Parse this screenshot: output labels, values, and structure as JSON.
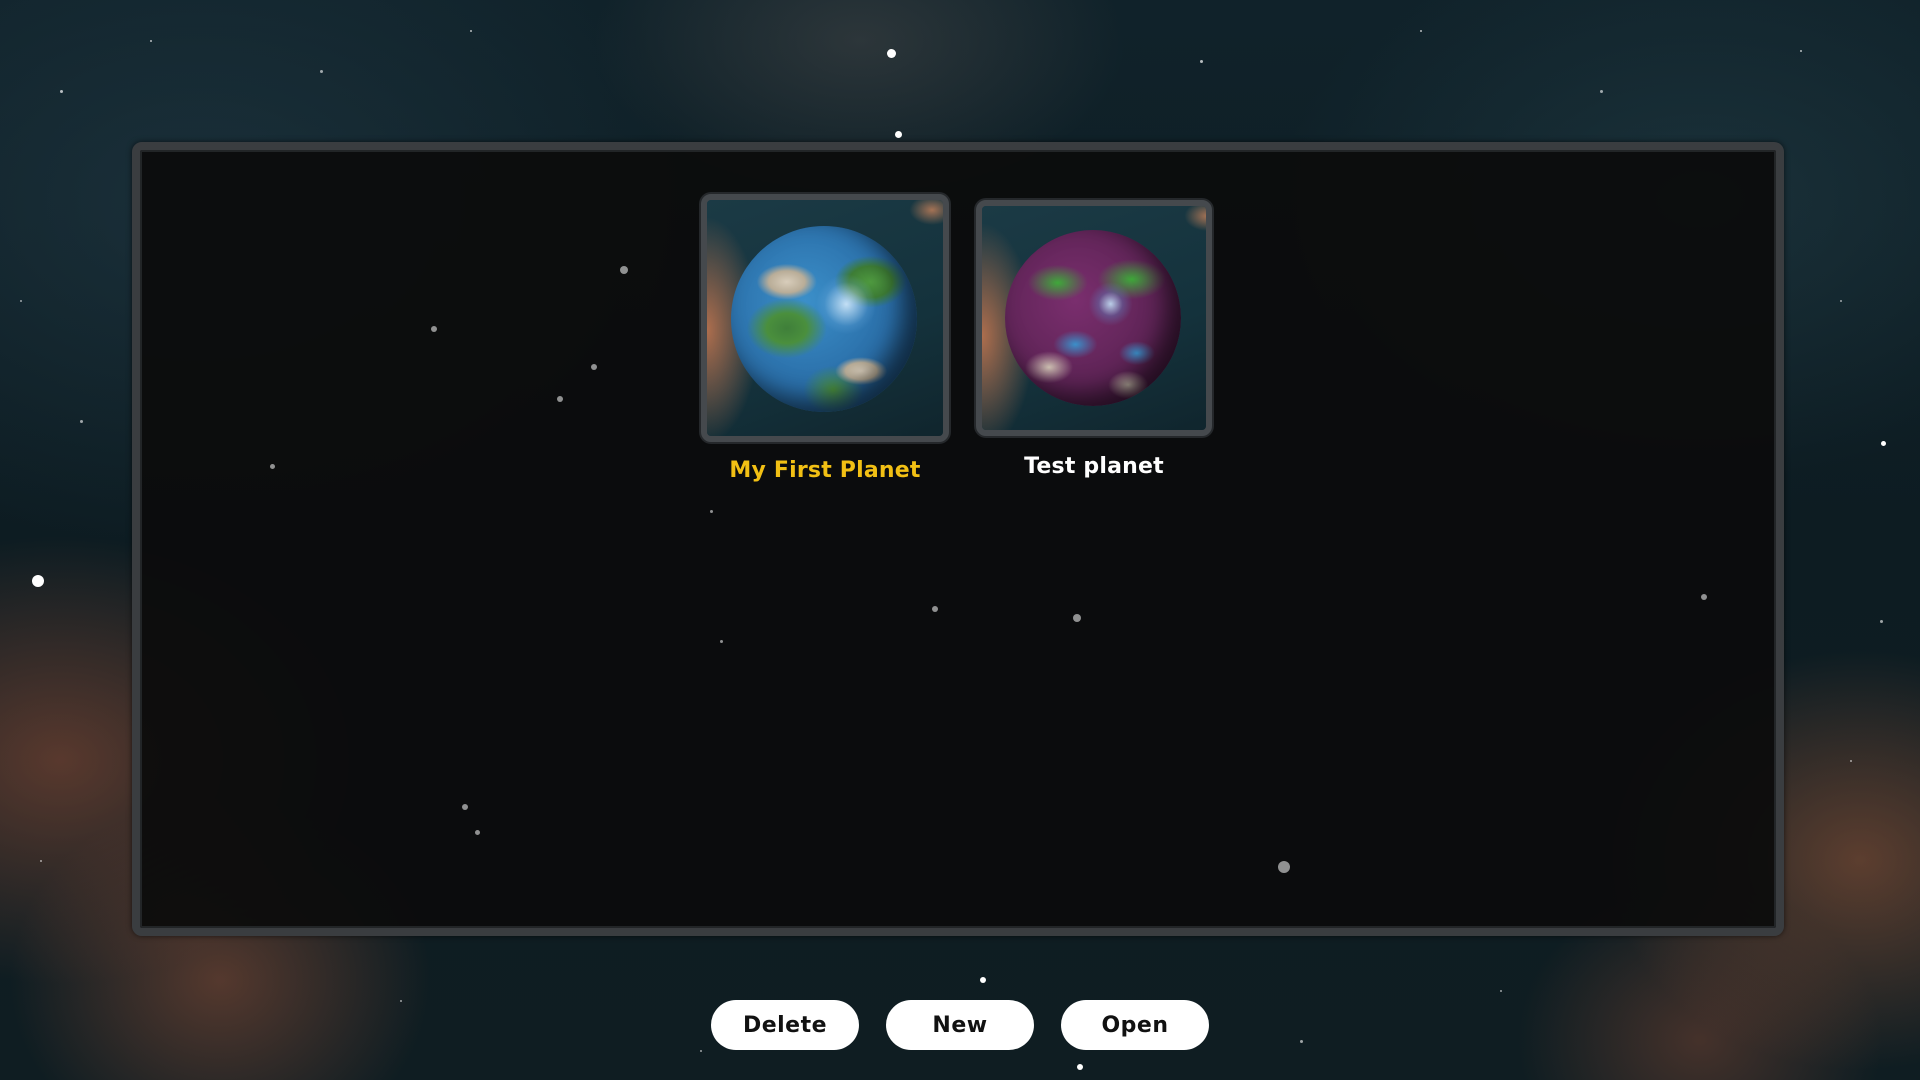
{
  "planets": [
    {
      "name": "My First Planet",
      "selected": true,
      "theme": "earth",
      "label_color": "#f2c014"
    },
    {
      "name": "Test planet",
      "selected": false,
      "theme": "alien",
      "label_color": "#ffffff"
    }
  ],
  "actions": {
    "delete_label": "Delete",
    "new_label": "New",
    "open_label": "Open"
  },
  "colors": {
    "selected_label": "#f2c014",
    "label": "#ffffff",
    "button_bg": "#ffffff",
    "button_text": "#111111",
    "panel_border": "#3a3d40"
  }
}
